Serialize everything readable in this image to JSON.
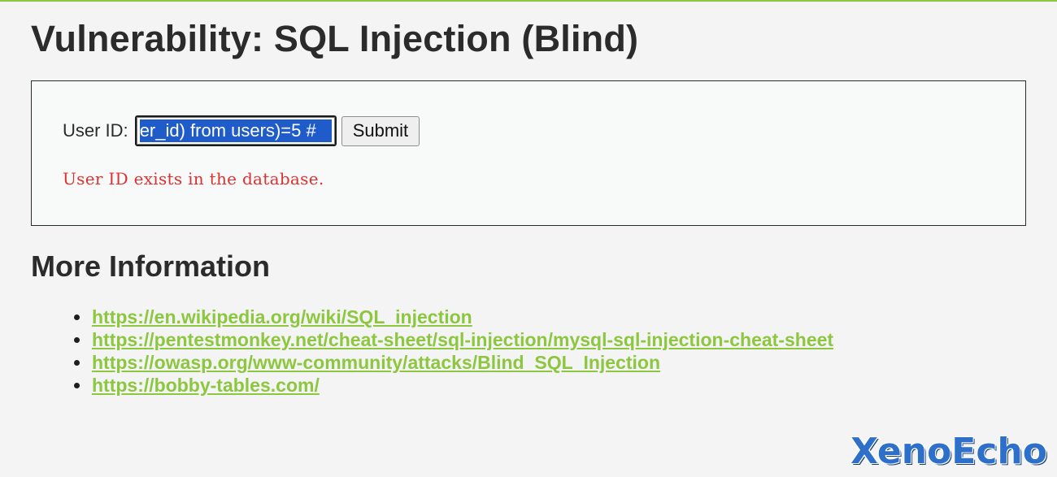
{
  "page": {
    "title": "Vulnerability: SQL Injection (Blind)"
  },
  "form": {
    "label": "User ID:",
    "input_value": "er_id) from users)=5 #",
    "submit_label": "Submit",
    "result_message": "User ID exists in the database."
  },
  "more_info": {
    "heading": "More Information",
    "links": [
      "https://en.wikipedia.org/wiki/SQL_injection",
      "https://pentestmonkey.net/cheat-sheet/sql-injection/mysql-sql-injection-cheat-sheet",
      "https://owasp.org/www-community/attacks/Blind_SQL_Injection",
      "https://bobby-tables.com/"
    ]
  },
  "watermark": "XenoEcho",
  "colors": {
    "accent": "#8dc63f",
    "error": "#e03030",
    "selection": "#1f5cc9",
    "watermark": "#2d6fc9"
  }
}
